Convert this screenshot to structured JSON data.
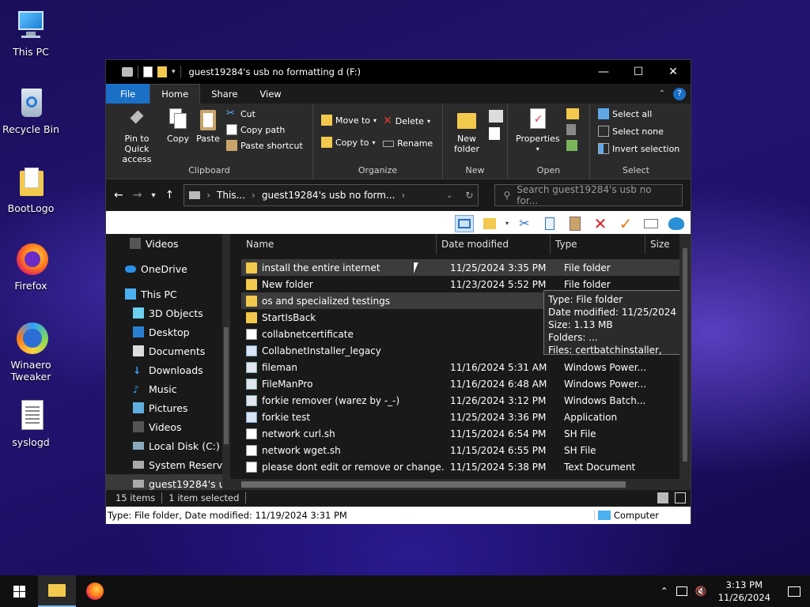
{
  "desktop": {
    "icons": [
      {
        "label": "This PC"
      },
      {
        "label": "Recycle Bin"
      },
      {
        "label": "BootLogo"
      },
      {
        "label": "Firefox"
      },
      {
        "label": "Winaero Tweaker"
      },
      {
        "label": "syslogd"
      }
    ]
  },
  "window": {
    "title": "guest19284's usb no formatting d (F:)",
    "controls": {
      "minimize": "—",
      "maximize": "☐",
      "close": "✕"
    },
    "menu_tabs": {
      "file": "File",
      "home": "Home",
      "share": "Share",
      "view": "View"
    },
    "ribbon": {
      "clipboard": {
        "group": "Clipboard",
        "pin": "Pin to Quick access",
        "copy": "Copy",
        "paste": "Paste",
        "cut": "Cut",
        "copy_path": "Copy path",
        "paste_shortcut": "Paste shortcut"
      },
      "organize": {
        "group": "Organize",
        "move_to": "Move to",
        "copy_to": "Copy to",
        "delete": "Delete",
        "rename": "Rename"
      },
      "new": {
        "group": "New",
        "new_folder": "New folder"
      },
      "open": {
        "group": "Open",
        "properties": "Properties"
      },
      "select": {
        "group": "Select",
        "select_all": "Select all",
        "select_none": "Select none",
        "invert": "Invert selection"
      }
    },
    "address": {
      "crumb1": "This...",
      "crumb2": "guest19284's usb no form...",
      "search_placeholder": "Search guest19284's usb no for..."
    },
    "nav_pane": [
      {
        "label": "Videos"
      },
      {
        "label": "OneDrive"
      },
      {
        "label": "This PC"
      },
      {
        "label": "3D Objects"
      },
      {
        "label": "Desktop"
      },
      {
        "label": "Documents"
      },
      {
        "label": "Downloads"
      },
      {
        "label": "Music"
      },
      {
        "label": "Pictures"
      },
      {
        "label": "Videos"
      },
      {
        "label": "Local Disk (C:)"
      },
      {
        "label": "System Reserv"
      },
      {
        "label": "guest19284's u"
      }
    ],
    "columns": {
      "name": "Name",
      "date": "Date modified",
      "type": "Type",
      "size": "Size"
    },
    "files": [
      {
        "name": "install the entire internet",
        "date": "11/25/2024 3:35 PM",
        "type": "File folder"
      },
      {
        "name": "New folder",
        "date": "11/23/2024 5:52 PM",
        "type": "File folder"
      },
      {
        "name": "os and specialized testings",
        "date": "",
        "type": ""
      },
      {
        "name": "StartIsBack",
        "date": "",
        "type": ""
      },
      {
        "name": "collabnetcertificate",
        "date": "",
        "type": "ific..."
      },
      {
        "name": "CollabnetInstaller_legacy",
        "date": "",
        "type": "Application"
      },
      {
        "name": "fileman",
        "date": "11/16/2024 5:31 AM",
        "type": "Windows Power..."
      },
      {
        "name": "FileManPro",
        "date": "11/16/2024 6:48 AM",
        "type": "Windows Power..."
      },
      {
        "name": "forkie remover  (warez by -_-)",
        "date": "11/26/2024 3:12 PM",
        "type": "Windows Batch..."
      },
      {
        "name": "forkie test",
        "date": "11/25/2024 3:36 PM",
        "type": "Application"
      },
      {
        "name": "network curl.sh",
        "date": "11/15/2024 6:54 PM",
        "type": "SH File"
      },
      {
        "name": "network wget.sh",
        "date": "11/15/2024 6:55 PM",
        "type": "SH File"
      },
      {
        "name": "please dont edit or remove or change...",
        "date": "11/15/2024 5:38 PM",
        "type": "Text Document"
      }
    ],
    "tooltip": {
      "type": "Type: File folder",
      "date": "Date modified: 11/25/2024 3:35 PM",
      "size": "Size: 1.13 MB",
      "folders": "Folders: ...",
      "files": "Files: certbatchinstaller,"
    },
    "status": {
      "items": "15 items",
      "selected": "1 item selected"
    },
    "details_bar": {
      "text": "Type: File folder, Date modified: 11/19/2024 3:31 PM",
      "location": "Computer"
    }
  },
  "taskbar": {
    "time": "3:13 PM",
    "date": "11/26/2024"
  }
}
